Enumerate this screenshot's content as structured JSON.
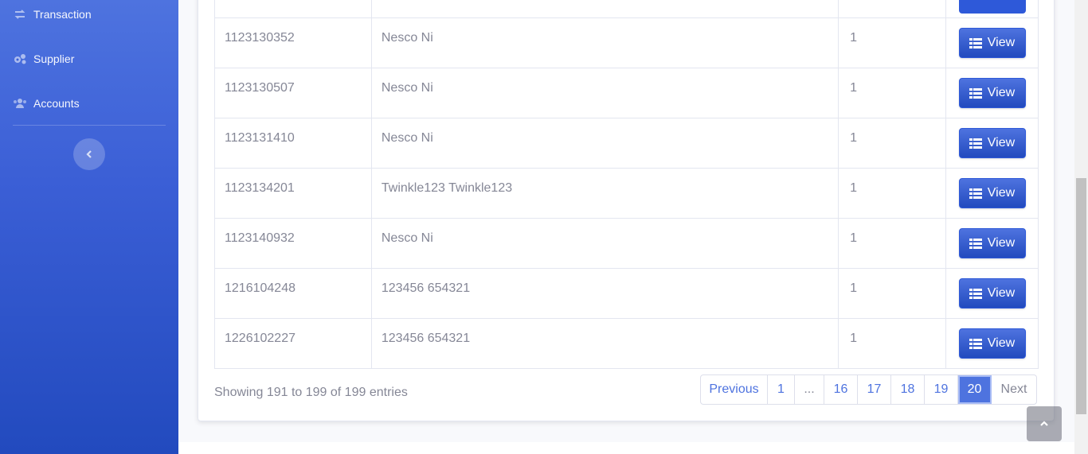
{
  "sidebar": {
    "items": [
      {
        "label": "Transaction",
        "icon": "exchange-icon"
      },
      {
        "label": "Supplier",
        "icon": "cogs-icon"
      },
      {
        "label": "Accounts",
        "icon": "users-icon"
      }
    ],
    "toggle_icon": "chevron-left-icon"
  },
  "table": {
    "rows": [
      {
        "id": "1123130352",
        "name": "Nesco Ni",
        "count": "1",
        "action": "View"
      },
      {
        "id": "1123130507",
        "name": "Nesco Ni",
        "count": "1",
        "action": "View"
      },
      {
        "id": "1123131410",
        "name": "Nesco Ni",
        "count": "1",
        "action": "View"
      },
      {
        "id": "1123134201",
        "name": "Twinkle123 Twinkle123",
        "count": "1",
        "action": "View"
      },
      {
        "id": "1123140932",
        "name": "Nesco Ni",
        "count": "1",
        "action": "View"
      },
      {
        "id": "1216104248",
        "name": "123456 654321",
        "count": "1",
        "action": "View"
      },
      {
        "id": "1226102227",
        "name": "123456 654321",
        "count": "1",
        "action": "View"
      }
    ]
  },
  "info": "Showing 191 to 199 of 199 entries",
  "pagination": {
    "previous": "Previous",
    "first": "1",
    "ellipsis": "...",
    "pages": [
      "16",
      "17",
      "18",
      "19",
      "20"
    ],
    "active": "20",
    "next": "Next"
  },
  "colors": {
    "primary": "#4e73df",
    "primary_dark": "#224abe",
    "text_muted": "#858796",
    "border": "#e3e6f0"
  }
}
